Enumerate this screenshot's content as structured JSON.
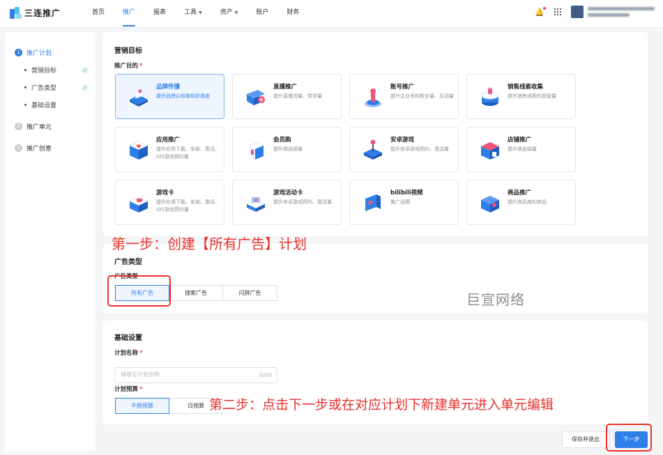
{
  "app": {
    "logo_text": "三连推广"
  },
  "nav": [
    {
      "label": "首页",
      "active": false,
      "dropdown": false
    },
    {
      "label": "推广",
      "active": true,
      "dropdown": false
    },
    {
      "label": "报表",
      "active": false,
      "dropdown": false
    },
    {
      "label": "工具",
      "active": false,
      "dropdown": true
    },
    {
      "label": "资产",
      "active": false,
      "dropdown": true
    },
    {
      "label": "账户",
      "active": false,
      "dropdown": false
    },
    {
      "label": "财务",
      "active": false,
      "dropdown": false
    }
  ],
  "topbar_icons": {
    "notification": "bell-icon",
    "apps": "grid-icon"
  },
  "sidebar": {
    "steps": [
      {
        "num": "1",
        "label": "推广计划",
        "active": true
      },
      {
        "num": "2",
        "label": "推广单元",
        "active": false
      },
      {
        "num": "3",
        "label": "推广创意",
        "active": false
      }
    ],
    "substeps": [
      {
        "label": "营销目标",
        "done": true
      },
      {
        "label": "广告类型",
        "done": true
      },
      {
        "label": "基础设置",
        "done": false
      }
    ]
  },
  "marketing": {
    "title": "营销目标",
    "field_label": "推广目的",
    "objectives": [
      {
        "name": "品牌传播",
        "desc": "提升品牌认知度和好感度",
        "selected": true,
        "icon": "brand-broadcast-icon"
      },
      {
        "name": "直播推广",
        "desc": "提升直播流量、带货量",
        "selected": false,
        "icon": "live-stream-icon"
      },
      {
        "name": "账号推广",
        "desc": "提升企业号的粉丝量、互动量",
        "selected": false,
        "icon": "account-icon"
      },
      {
        "name": "销售线索收集",
        "desc": "提升销售线索的获取量",
        "selected": false,
        "icon": "sales-leads-icon"
      },
      {
        "name": "应用推广",
        "desc": "提升应用下载、安装、激活、iOS游戏预约量",
        "selected": false,
        "icon": "app-icon"
      },
      {
        "name": "会员购",
        "desc": "提升商品销量",
        "selected": false,
        "icon": "member-shop-icon"
      },
      {
        "name": "安卓游戏",
        "desc": "提升安卓游戏预约、激活量",
        "selected": false,
        "icon": "android-game-icon"
      },
      {
        "name": "店铺推广",
        "desc": "提升商品销量",
        "selected": false,
        "icon": "store-icon"
      },
      {
        "name": "游戏卡",
        "desc": "提升应用下载、安装、激活、iOS游戏预约量",
        "selected": false,
        "icon": "game-card-icon"
      },
      {
        "name": "游戏活动卡",
        "desc": "提升安卓游戏预约、激活量",
        "selected": false,
        "icon": "game-event-card-icon"
      },
      {
        "name": "bilibili视频",
        "desc": "推广品牌",
        "selected": false,
        "icon": "bilibili-video-icon"
      },
      {
        "name": "商品推广",
        "desc": "提升商品库的商品",
        "selected": false,
        "icon": "product-icon"
      }
    ]
  },
  "ad_type": {
    "title": "广告类型",
    "field_label": "广告类型",
    "options": [
      {
        "label": "所有广告",
        "active": true
      },
      {
        "label": "搜索广告",
        "active": false
      },
      {
        "label": "闪屏广告",
        "active": false
      }
    ]
  },
  "basic": {
    "title": "基础设置",
    "plan_name_label": "计划名称",
    "plan_name_value": "",
    "plan_name_placeholder": "请填写计划名称",
    "plan_name_counter": "0/60",
    "budget_label": "计划预算",
    "budget_options": [
      {
        "label": "不限预算",
        "active": true
      },
      {
        "label": "日预算",
        "active": false
      }
    ]
  },
  "footer": {
    "save_exit": "保存并退出",
    "next": "下一步"
  },
  "annotations": {
    "step1": "第一步：创建【所有广告】计划",
    "step2": "第二步：点击下一步或在对应计划下新建单元进入单元编辑",
    "watermark": "巨宣网络"
  },
  "colors": {
    "accent": "#2f7fe9",
    "annotation": "#e8312b"
  }
}
